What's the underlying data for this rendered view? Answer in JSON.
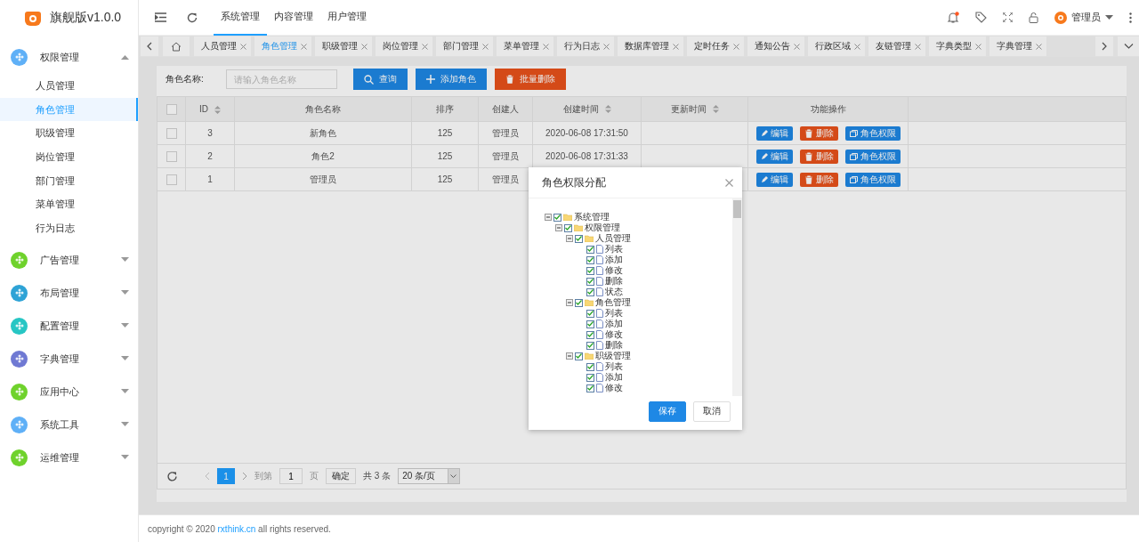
{
  "logo": {
    "title": "旗舰版v1.0.0"
  },
  "sidebar": {
    "items": [
      {
        "label": "权限管理",
        "color": "#5fb0f7",
        "expanded": true,
        "children": [
          {
            "label": "人员管理",
            "selected": false
          },
          {
            "label": "角色管理",
            "selected": true
          },
          {
            "label": "职级管理",
            "selected": false
          },
          {
            "label": "岗位管理",
            "selected": false
          },
          {
            "label": "部门管理",
            "selected": false
          },
          {
            "label": "菜单管理",
            "selected": false
          },
          {
            "label": "行为日志",
            "selected": false
          }
        ]
      },
      {
        "label": "广告管理",
        "color": "#6fd22c",
        "expanded": false
      },
      {
        "label": "布局管理",
        "color": "#2ea3d6",
        "expanded": false
      },
      {
        "label": "配置管理",
        "color": "#27c6c4",
        "expanded": false
      },
      {
        "label": "字典管理",
        "color": "#6f79d3",
        "expanded": false
      },
      {
        "label": "应用中心",
        "color": "#6fd22c",
        "expanded": false
      },
      {
        "label": "系统工具",
        "color": "#5fb0f7",
        "expanded": false
      },
      {
        "label": "运维管理",
        "color": "#6fd22c",
        "expanded": false
      }
    ]
  },
  "top_nav": [
    {
      "label": "系统管理",
      "selected": true
    },
    {
      "label": "内容管理",
      "selected": false
    },
    {
      "label": "用户管理",
      "selected": false
    }
  ],
  "user": {
    "name": "管理员",
    "has_notification": true
  },
  "page_tabs": [
    {
      "label": "人员管理",
      "selected": false
    },
    {
      "label": "角色管理",
      "selected": true
    },
    {
      "label": "职级管理",
      "selected": false
    },
    {
      "label": "岗位管理",
      "selected": false
    },
    {
      "label": "部门管理",
      "selected": false
    },
    {
      "label": "菜单管理",
      "selected": false
    },
    {
      "label": "行为日志",
      "selected": false
    },
    {
      "label": "数据库管理",
      "selected": false
    },
    {
      "label": "定时任务",
      "selected": false
    },
    {
      "label": "通知公告",
      "selected": false
    },
    {
      "label": "行政区域",
      "selected": false
    },
    {
      "label": "友链管理",
      "selected": false
    },
    {
      "label": "字典类型",
      "selected": false
    },
    {
      "label": "字典管理",
      "selected": false
    }
  ],
  "search": {
    "label": "角色名称:",
    "placeholder": "请输入角色名称",
    "buttons": [
      {
        "label": "查询",
        "kind": "search"
      },
      {
        "label": "添加角色",
        "kind": "add"
      },
      {
        "label": "批量删除",
        "kind": "delete"
      }
    ]
  },
  "table": {
    "all_checked": false,
    "columns": [
      {
        "label": "ID",
        "sortable": true
      },
      {
        "label": "角色名称",
        "sortable": false
      },
      {
        "label": "排序",
        "sortable": false
      },
      {
        "label": "创建人",
        "sortable": false
      },
      {
        "label": "创建时间",
        "sortable": true
      },
      {
        "label": "更新时间",
        "sortable": true
      },
      {
        "label": "功能操作",
        "sortable": false
      }
    ],
    "rows": [
      {
        "checked": false,
        "cells": [
          "3",
          "新角色",
          "125",
          "管理员",
          "2020-06-08 17:31:50",
          ""
        ],
        "actions": [
          "编辑",
          "删除",
          "角色权限"
        ]
      },
      {
        "checked": false,
        "cells": [
          "2",
          "角色2",
          "125",
          "管理员",
          "2020-06-08 17:31:33",
          ""
        ],
        "actions": [
          "编辑",
          "删除",
          "角色权限"
        ]
      },
      {
        "checked": false,
        "cells": [
          "1",
          "管理员",
          "125",
          "管理员",
          "",
          ""
        ],
        "actions": [
          "编辑",
          "删除",
          "角色权限"
        ]
      }
    ]
  },
  "pagination": {
    "current": "1",
    "goto_label": "到第",
    "goto_value": "1",
    "page_label": "页",
    "confirm": "确定",
    "total": "共 3 条",
    "page_size": "20 条/页"
  },
  "footer": {
    "text": "copyright © 2020 ",
    "link": "rxthink.cn",
    "suffix": " all rights reserved."
  },
  "dialog": {
    "title": "角色权限分配",
    "tree": [
      {
        "label": "系统管理",
        "checked": true,
        "kind": "folder",
        "children": [
          {
            "label": "权限管理",
            "checked": true,
            "kind": "folder",
            "children": [
              {
                "label": "人员管理",
                "checked": true,
                "kind": "folder",
                "children": [
                  {
                    "label": "列表",
                    "checked": true,
                    "kind": "file"
                  },
                  {
                    "label": "添加",
                    "checked": true,
                    "kind": "file"
                  },
                  {
                    "label": "修改",
                    "checked": true,
                    "kind": "file"
                  },
                  {
                    "label": "删除",
                    "checked": true,
                    "kind": "file"
                  },
                  {
                    "label": "状态",
                    "checked": true,
                    "kind": "file"
                  }
                ]
              },
              {
                "label": "角色管理",
                "checked": true,
                "kind": "folder",
                "children": [
                  {
                    "label": "列表",
                    "checked": true,
                    "kind": "file"
                  },
                  {
                    "label": "添加",
                    "checked": true,
                    "kind": "file"
                  },
                  {
                    "label": "修改",
                    "checked": true,
                    "kind": "file"
                  },
                  {
                    "label": "删除",
                    "checked": true,
                    "kind": "file"
                  }
                ]
              },
              {
                "label": "职级管理",
                "checked": true,
                "kind": "folder",
                "children": [
                  {
                    "label": "列表",
                    "checked": true,
                    "kind": "file"
                  },
                  {
                    "label": "添加",
                    "checked": true,
                    "kind": "file"
                  },
                  {
                    "label": "修改",
                    "checked": true,
                    "kind": "file"
                  }
                ]
              }
            ]
          }
        ]
      }
    ],
    "buttons": [
      {
        "label": "保存",
        "kind": "primary"
      },
      {
        "label": "取消",
        "kind": "default"
      }
    ]
  }
}
